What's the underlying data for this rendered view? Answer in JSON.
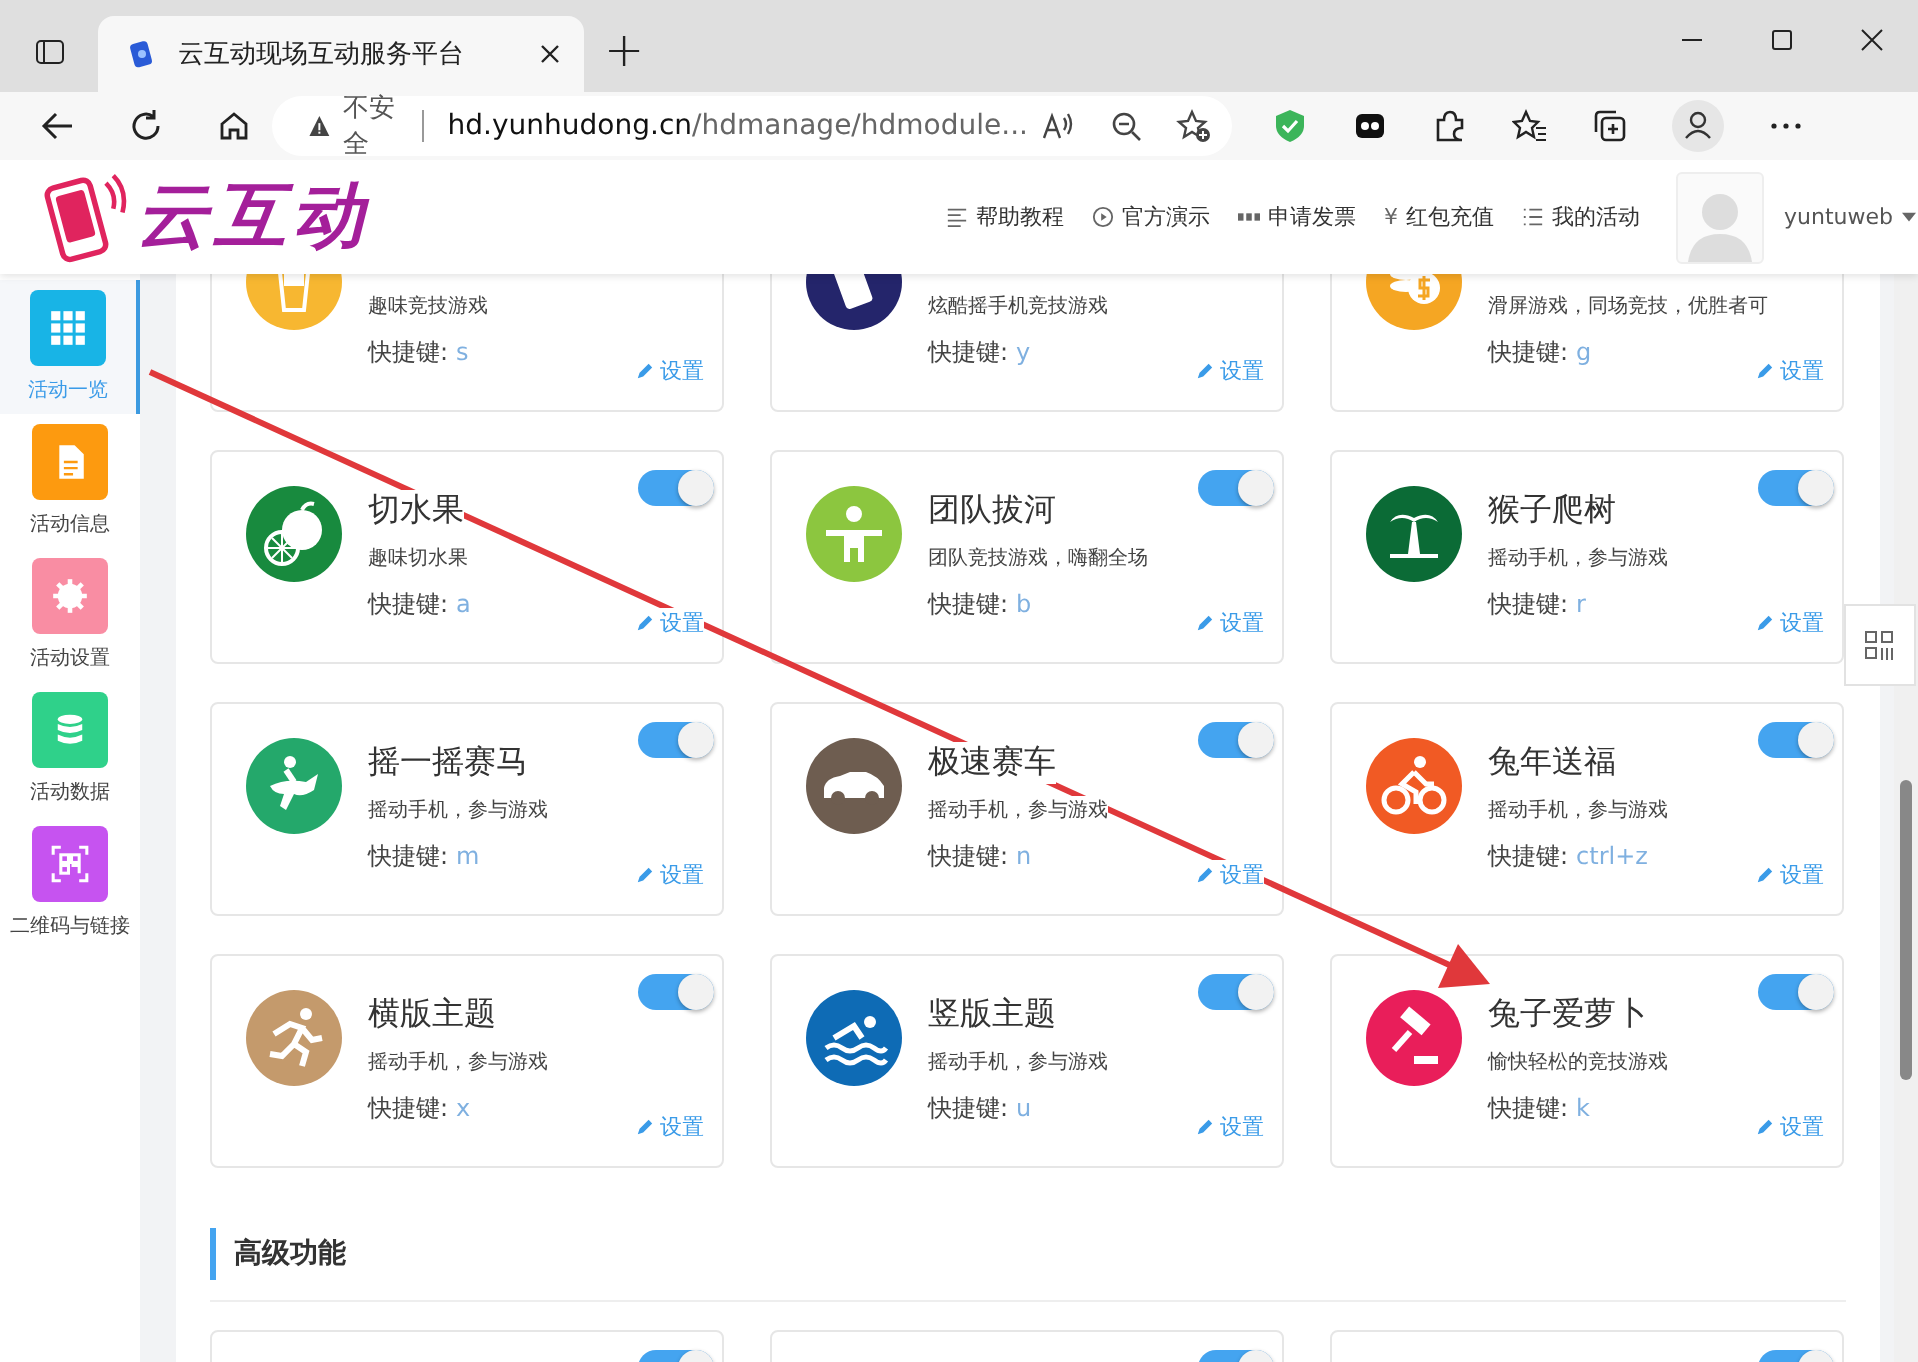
{
  "browser": {
    "tab_title": "云互动现场互动服务平台",
    "new_tab": "+",
    "security": "不安全",
    "url_domain": "hd.yunhudong.cn",
    "url_path": "/hdmanage/hdmodule..."
  },
  "header": {
    "logo": "云互动",
    "nav": [
      {
        "label": "帮助教程"
      },
      {
        "label": "官方演示"
      },
      {
        "label": "申请发票"
      },
      {
        "label": "红包充值",
        "symbol": "¥"
      },
      {
        "label": "我的活动"
      }
    ],
    "username": "yuntuweb"
  },
  "sidebar": {
    "items": [
      {
        "label": "活动一览",
        "selected": true,
        "color": "#18b4e6"
      },
      {
        "label": "活动信息",
        "selected": false,
        "color": "#fd9a0f"
      },
      {
        "label": "活动设置",
        "selected": false,
        "color": "#f98da3"
      },
      {
        "label": "活动数据",
        "selected": false,
        "color": "#2fd18a"
      },
      {
        "label": "二维码与链接",
        "selected": false,
        "color": "#c653f0"
      }
    ]
  },
  "cards": [
    {
      "description": "趣味竞技游戏",
      "shortcut_label": "快捷键:",
      "shortcut": "s",
      "settings": "设置",
      "color": "#f7b731"
    },
    {
      "description": "炫酷摇手机竞技游戏",
      "shortcut_label": "快捷键:",
      "shortcut": "y",
      "settings": "设置",
      "color": "#24256b"
    },
    {
      "description": "滑屏游戏，同场竞技，优胜者可",
      "shortcut_label": "快捷键:",
      "shortcut": "g",
      "settings": "设置",
      "color": "#f5a623"
    },
    {
      "title": "切水果",
      "description": "趣味切水果",
      "shortcut_label": "快捷键:",
      "shortcut": "a",
      "settings": "设置",
      "on": true,
      "color": "#188a3e"
    },
    {
      "title": "团队拔河",
      "description": "团队竞技游戏，嗨翻全场",
      "shortcut_label": "快捷键:",
      "shortcut": "b",
      "settings": "设置",
      "on": true,
      "color": "#8cc63f"
    },
    {
      "title": "猴子爬树",
      "description": "摇动手机，参与游戏",
      "shortcut_label": "快捷键:",
      "shortcut": "r",
      "settings": "设置",
      "on": true,
      "color": "#0b6b36"
    },
    {
      "title": "摇一摇赛马",
      "description": "摇动手机，参与游戏",
      "shortcut_label": "快捷键:",
      "shortcut": "m",
      "settings": "设置",
      "on": true,
      "color": "#24a86b"
    },
    {
      "title": "极速赛车",
      "description": "摇动手机，参与游戏",
      "shortcut_label": "快捷键:",
      "shortcut": "n",
      "settings": "设置",
      "on": true,
      "color": "#6e5d50"
    },
    {
      "title": "兔年送福",
      "description": "摇动手机，参与游戏",
      "shortcut_label": "快捷键:",
      "shortcut": "ctrl+z",
      "settings": "设置",
      "on": true,
      "color": "#f15a24"
    },
    {
      "title": "横版主题",
      "description": "摇动手机，参与游戏",
      "shortcut_label": "快捷键:",
      "shortcut": "x",
      "settings": "设置",
      "on": true,
      "color": "#c49a6c"
    },
    {
      "title": "竖版主题",
      "description": "摇动手机，参与游戏",
      "shortcut_label": "快捷键:",
      "shortcut": "u",
      "settings": "设置",
      "on": true,
      "color": "#0e6bb5"
    },
    {
      "title": "兔子爱萝卜",
      "description": "愉快轻松的竞技游戏",
      "shortcut_label": "快捷键:",
      "shortcut": "k",
      "settings": "设置",
      "on": true,
      "color": "#e91e5a"
    }
  ],
  "section": {
    "title": "高级功能",
    "cards": [
      {
        "on": true
      },
      {
        "on": true
      },
      {
        "on": true
      }
    ]
  }
}
